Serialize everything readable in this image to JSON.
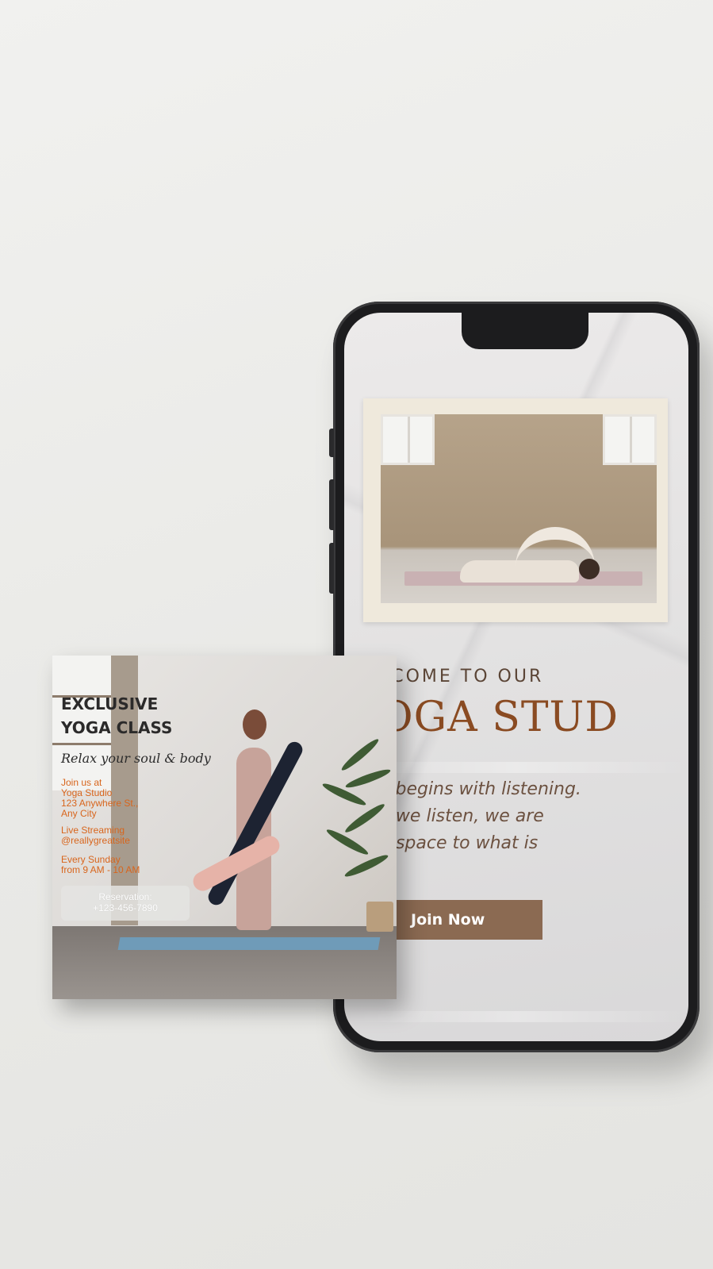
{
  "phone": {
    "welcome_text": "LCOME TO OUR",
    "studio_title": "OGA STUD",
    "tagline_lines": [
      "a begins with listening.",
      "n we listen, we are",
      "g space to what is"
    ],
    "join_button_label": "Join Now"
  },
  "poster": {
    "title_line1": "EXCLUSIVE",
    "title_line2": "YOGA CLASS",
    "script_text": "Relax your soul & body",
    "address": [
      "Join us at",
      "Yoga Studio",
      "123 Anywhere St.,",
      "Any City"
    ],
    "streaming": [
      "Live Streaming",
      "@reallygreatsite"
    ],
    "schedule": [
      "Every Sunday",
      "from 9 AM - 10 AM"
    ],
    "reservation": [
      "Reservation:",
      "+123-456-7890"
    ]
  },
  "colors": {
    "accent_brown": "#8a4b22",
    "button_brown": "#8b6a52",
    "poster_orange": "#d8651c"
  }
}
